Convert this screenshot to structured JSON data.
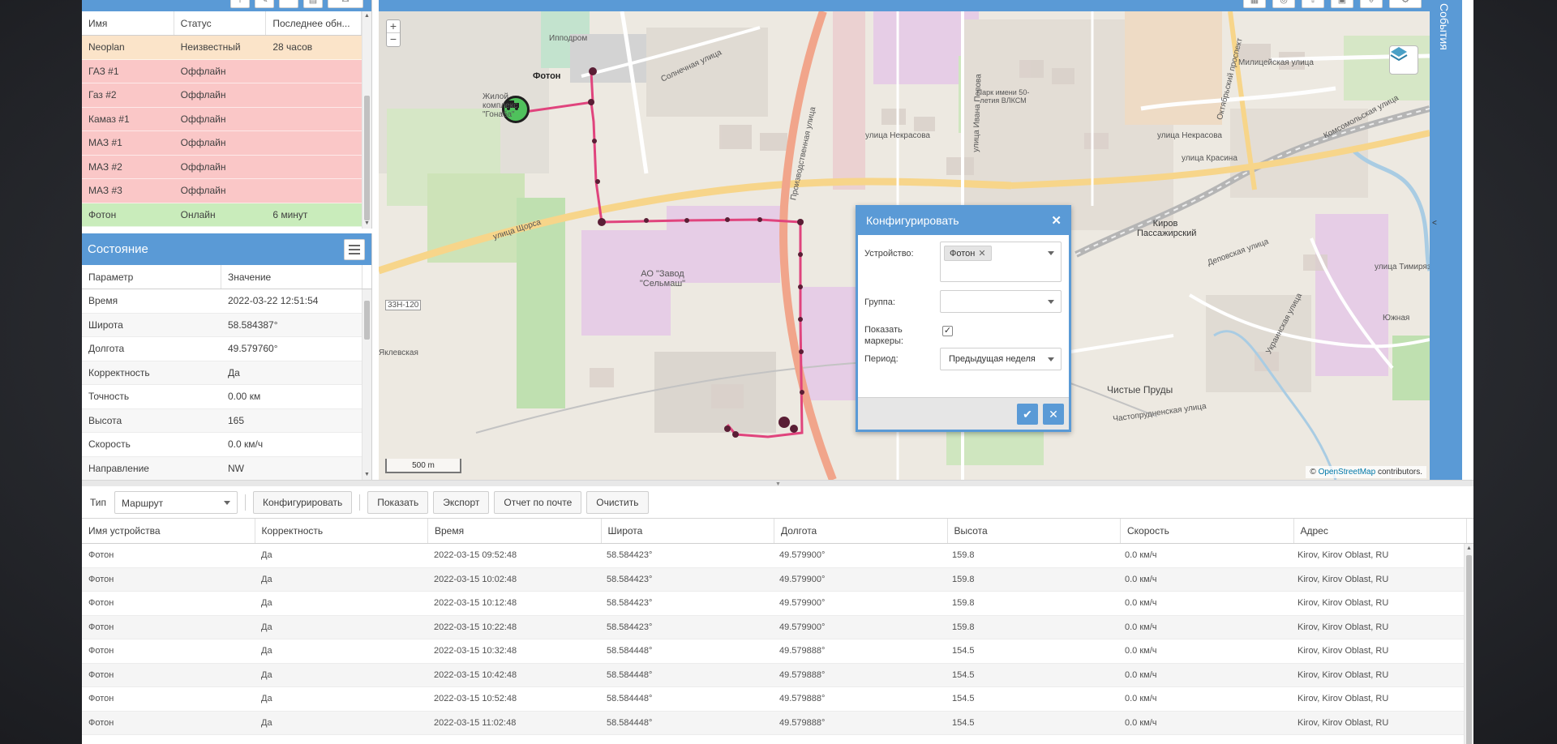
{
  "devices": {
    "columns": [
      "Имя",
      "Статус",
      "Последнее обн..."
    ],
    "rows": [
      {
        "name": "Neoplan",
        "status": "Неизвестный",
        "last": "28 часов"
      },
      {
        "name": "ГАЗ #1",
        "status": "Оффлайн",
        "last": ""
      },
      {
        "name": "Газ #2",
        "status": "Оффлайн",
        "last": ""
      },
      {
        "name": "Камаз #1",
        "status": "Оффлайн",
        "last": ""
      },
      {
        "name": "МАЗ #1",
        "status": "Оффлайн",
        "last": ""
      },
      {
        "name": "МАЗ #2",
        "status": "Оффлайн",
        "last": ""
      },
      {
        "name": "МАЗ #3",
        "status": "Оффлайн",
        "last": ""
      },
      {
        "name": "Фотон",
        "status": "Онлайн",
        "last": "6 минут"
      }
    ]
  },
  "state": {
    "title": "Состояние",
    "columns": [
      "Параметр",
      "Значение"
    ],
    "rows": [
      {
        "param": "Время",
        "value": "2022-03-22 12:51:54"
      },
      {
        "param": "Широта",
        "value": "58.584387°"
      },
      {
        "param": "Долгота",
        "value": "49.579760°"
      },
      {
        "param": "Корректность",
        "value": "Да"
      },
      {
        "param": "Точность",
        "value": "0.00 км"
      },
      {
        "param": "Высота",
        "value": "165"
      },
      {
        "param": "Скорость",
        "value": "0.0 км/ч"
      },
      {
        "param": "Направление",
        "value": "NW"
      }
    ]
  },
  "map": {
    "zoom_in": "+",
    "zoom_out": "−",
    "scale": "500 m",
    "attribution_prefix": "© ",
    "attribution_link": "OpenStreetMap",
    "attribution_suffix": " contributors.",
    "vehicle_label": "Фотон",
    "labels": {
      "hippodrome": "Ипподром",
      "complex": "Жилой комплекс \"Гонаба\"",
      "solnechnaya": "Солнечная улица",
      "schorsa": "улица Щорса",
      "road": "33Н-120",
      "zavod": "АО \"Завод \"Сельмаш\"",
      "park": "Парк имени 50-летия ВЛКСМ",
      "nekrasova1": "улица Некрасова",
      "nekrasova2": "улица Некрасова",
      "militseiskaya": "Милицейская улица",
      "krasina": "улица Красина",
      "komsomolskaya": "Комсомольская улица",
      "kirov": "Киров Пассажирский",
      "timiryazeva": "улица Тимирязева",
      "chistye": "Чистые Пруды",
      "chastoprudnenskaya": "Частопрудненская улица",
      "yuzhnaya": "Южная",
      "yaklevskaya": "Яклевская",
      "proizvodstvennaya": "Производственная улица",
      "oktyabrsky": "Октябрьский проспект",
      "dekabristov": "Деповская улица",
      "ukrainskaya": "Украинская улица",
      "ivanova": "улица Ивана Попова"
    }
  },
  "events": {
    "label": "События",
    "arrow": "<"
  },
  "config_dialog": {
    "title": "Конфигурировать",
    "device_label": "Устройство:",
    "device_tag": "Фотон",
    "group_label": "Группа:",
    "markers_label": "Показать маркеры:",
    "markers_checked": "✓",
    "period_label": "Период:",
    "period_value": "Предыдущая неделя"
  },
  "toolbar": {
    "type_label": "Тип",
    "type_value": "Маршрут",
    "configure": "Конфигурировать",
    "show": "Показать",
    "export": "Экспорт",
    "email_report": "Отчет по почте",
    "clear": "Очистить"
  },
  "history": {
    "columns": [
      "Имя устройства",
      "Корректность",
      "Время",
      "Широта",
      "Долгота",
      "Высота",
      "Скорость",
      "Адрес"
    ],
    "rows": [
      [
        "Фотон",
        "Да",
        "2022-03-15 09:52:48",
        "58.584423°",
        "49.579900°",
        "159.8",
        "0.0 км/ч",
        "Kirov, Kirov Oblast, RU"
      ],
      [
        "Фотон",
        "Да",
        "2022-03-15 10:02:48",
        "58.584423°",
        "49.579900°",
        "159.8",
        "0.0 км/ч",
        "Kirov, Kirov Oblast, RU"
      ],
      [
        "Фотон",
        "Да",
        "2022-03-15 10:12:48",
        "58.584423°",
        "49.579900°",
        "159.8",
        "0.0 км/ч",
        "Kirov, Kirov Oblast, RU"
      ],
      [
        "Фотон",
        "Да",
        "2022-03-15 10:22:48",
        "58.584423°",
        "49.579900°",
        "159.8",
        "0.0 км/ч",
        "Kirov, Kirov Oblast, RU"
      ],
      [
        "Фотон",
        "Да",
        "2022-03-15 10:32:48",
        "58.584448°",
        "49.579888°",
        "154.5",
        "0.0 км/ч",
        "Kirov, Kirov Oblast, RU"
      ],
      [
        "Фотон",
        "Да",
        "2022-03-15 10:42:48",
        "58.584448°",
        "49.579888°",
        "154.5",
        "0.0 км/ч",
        "Kirov, Kirov Oblast, RU"
      ],
      [
        "Фотон",
        "Да",
        "2022-03-15 10:52:48",
        "58.584448°",
        "49.579888°",
        "154.5",
        "0.0 км/ч",
        "Kirov, Kirov Oblast, RU"
      ],
      [
        "Фотон",
        "Да",
        "2022-03-15 11:02:48",
        "58.584448°",
        "49.579888°",
        "154.5",
        "0.0 км/ч",
        "Kirov, Kirov Oblast, RU"
      ]
    ]
  },
  "colors": {
    "accent": "#5a9ad6",
    "route": "#e0447d",
    "row_unknown": "#fbe4c9",
    "row_offline": "#fac7c7",
    "row_online": "#c9ecbb"
  }
}
